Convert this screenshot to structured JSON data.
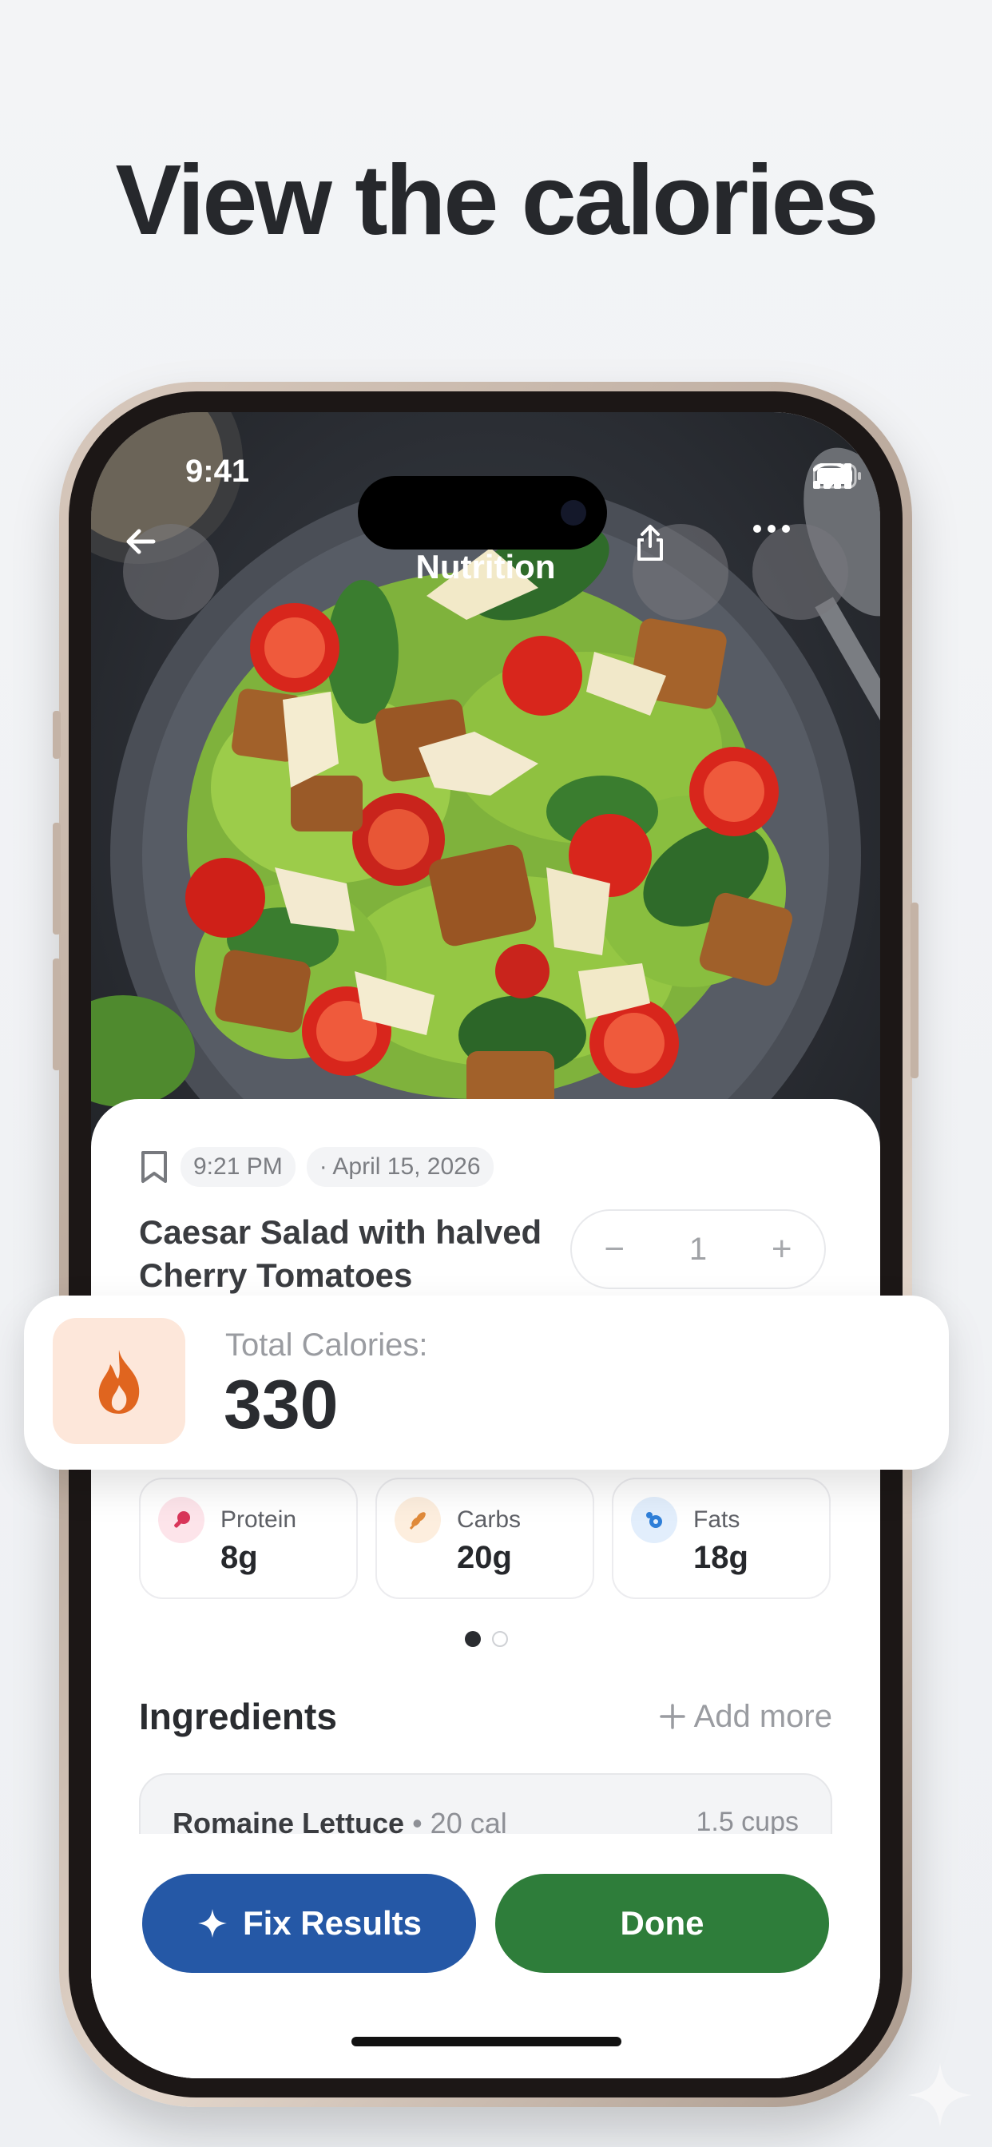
{
  "headline": "View the calories",
  "status_bar": {
    "time": "9:41"
  },
  "nav": {
    "title": "Nutrition"
  },
  "entry": {
    "time": "9:21 PM",
    "date": "· April 15, 2026",
    "food_name": "Caesar Salad with halved Cherry Tomatoes",
    "quantity": "1",
    "minus": "−",
    "plus": "+"
  },
  "calories": {
    "label": "Total Calories:",
    "value": "330"
  },
  "macros": [
    {
      "label": "Protein",
      "value": "8g",
      "color": "#d9365a"
    },
    {
      "label": "Carbs",
      "value": "20g",
      "color": "#e08a3a"
    },
    {
      "label": "Fats",
      "value": "18g",
      "color": "#2f7fd8"
    }
  ],
  "pager": {
    "active": 1,
    "total": 2
  },
  "ingredients": {
    "title": "Ingredients",
    "add_more": "Add more",
    "items": [
      {
        "name": "Romaine Lettuce",
        "calories": "• 20 cal",
        "amount": "1.5 cups"
      }
    ]
  },
  "buttons": {
    "fix_results": "Fix Results",
    "done": "Done",
    "fix_color": "#2558a6",
    "done_color": "#2e7d3a"
  },
  "icons": [
    "back-arrow-icon",
    "share-icon",
    "more-icon",
    "bookmark-icon",
    "flame-icon",
    "sparkle-icon",
    "plus-icon"
  ]
}
